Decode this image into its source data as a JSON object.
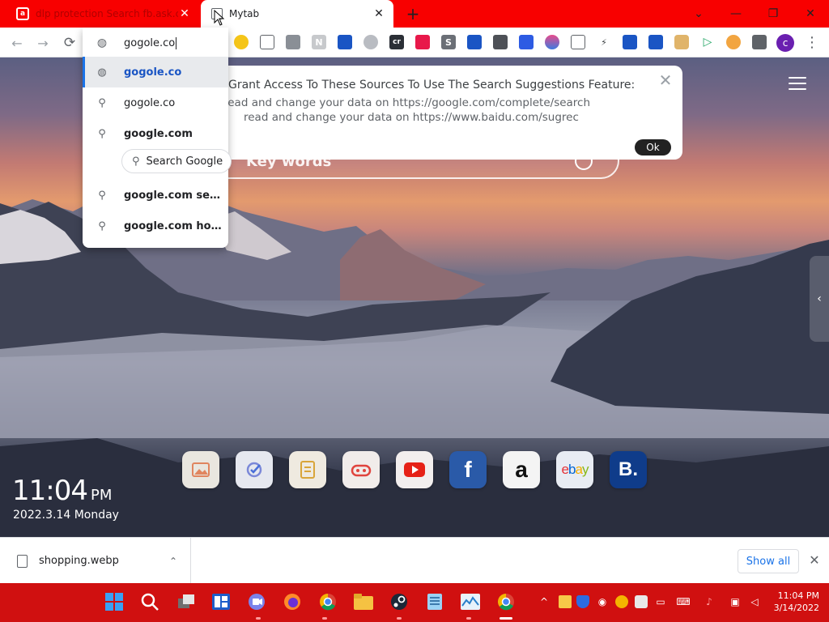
{
  "browser": {
    "tabs": [
      {
        "title": "dlp protection  Search fb.ask.com",
        "favicon": "ask-favicon-icon",
        "close": "✕"
      },
      {
        "title": "Mytab",
        "favicon": "page-icon",
        "close": "✕"
      }
    ],
    "new_tab": "+",
    "window_controls": {
      "search_tabs": "⌄",
      "minimize": "—",
      "restore": "❐",
      "close": "✕"
    }
  },
  "toolbar": {
    "back": "←",
    "forward": "→",
    "reload": "⟳",
    "avatar_letter": "c",
    "menu": "⋮",
    "extension_letters": {
      "s": "S",
      "n": "N",
      "cr": "cr"
    }
  },
  "omnibox": {
    "value": "gogole.co",
    "suggestions": [
      {
        "text": "gogole.co",
        "icon": "globe-icon",
        "style": "link"
      },
      {
        "text": "gogole.co",
        "icon": "search-icon",
        "style": "normal"
      },
      {
        "text": "google.com",
        "icon": "search-icon",
        "style": "bold"
      },
      {
        "text": "google.com search",
        "icon": "search-icon",
        "style": "bold"
      },
      {
        "text": "google.com homepage",
        "icon": "search-icon",
        "style": "bold"
      }
    ],
    "chip_label": "Search Google"
  },
  "dialog": {
    "heading": "Grant Access To These Sources To Use The Search Suggestions Feature:",
    "line1": "read and change your data on https://google.com/complete/search",
    "line2": "read and change your data on https://www.baidu.com/sugrec",
    "ok_label": "Ok",
    "close": "✕"
  },
  "search": {
    "placeholder": "Key words"
  },
  "shortcuts": [
    {
      "name": "gallery",
      "icon": "image-icon",
      "bg": "#e9e6df"
    },
    {
      "name": "check",
      "icon": "check-circle-icon",
      "bg": "#e6e8ef"
    },
    {
      "name": "notes",
      "icon": "notepad-icon",
      "bg": "#efeae0"
    },
    {
      "name": "game",
      "icon": "gamepad-icon",
      "bg": "#f1ecea"
    },
    {
      "name": "youtube",
      "icon": "youtube-icon",
      "bg": "#f2eeee"
    },
    {
      "name": "facebook",
      "icon": "facebook-icon",
      "bg": "#2a5aa8",
      "letter": "f"
    },
    {
      "name": "amazon",
      "icon": "amazon-icon",
      "bg": "#f4f4f4",
      "letter": "a"
    },
    {
      "name": "ebay",
      "icon": "ebay-icon",
      "bg": "#e8ecf3",
      "letters": [
        "e",
        "b",
        "a",
        "y"
      ]
    },
    {
      "name": "booking",
      "icon": "booking-icon",
      "bg": "#0f3c8a",
      "letter": "B."
    }
  ],
  "clock": {
    "time": "11:04",
    "ampm": "PM",
    "date": "2022.3.14 Monday"
  },
  "download": {
    "filename": "shopping.webp",
    "chevron": "⌃",
    "show_all": "Show all",
    "close": "✕"
  },
  "taskbar": {
    "time": "11:04 PM",
    "date": "3/14/2022"
  },
  "colors": {
    "tabstrip": "#f80000",
    "taskbar": "#d01010",
    "accent": "#1a73e8"
  }
}
